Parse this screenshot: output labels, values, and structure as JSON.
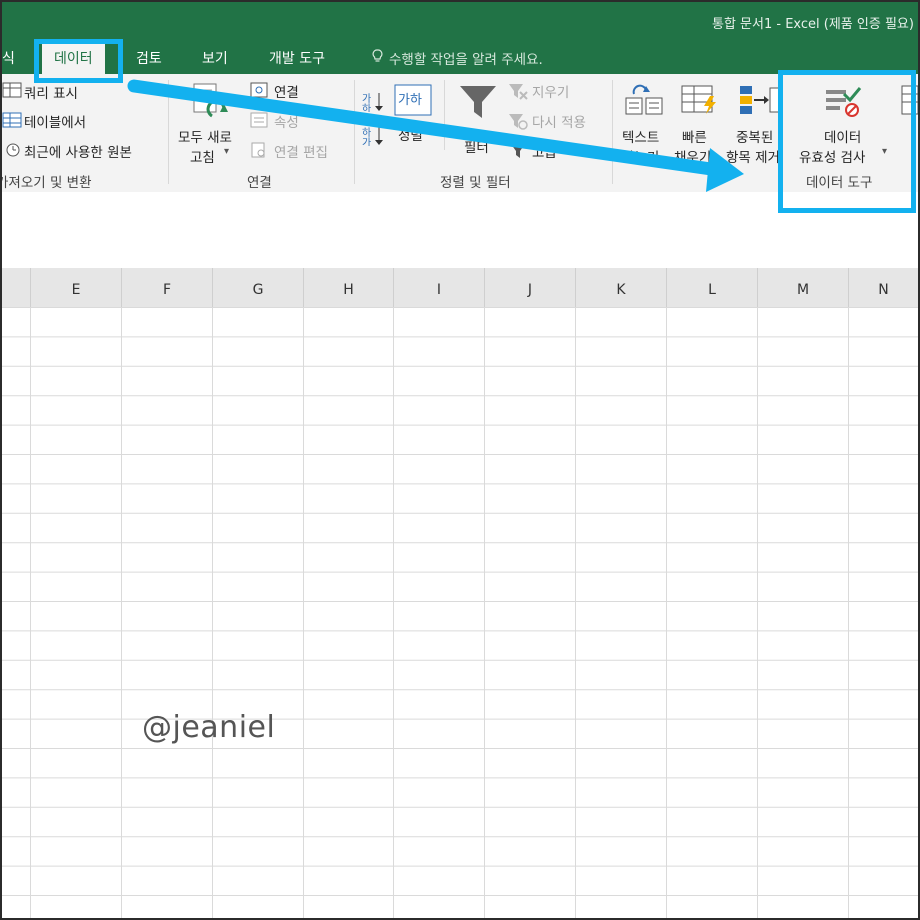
{
  "window": {
    "title": "통합 문서1 - Excel (제품 인증 필요)"
  },
  "tabs": {
    "partial_left": "식",
    "data": "데이터",
    "review": "검토",
    "view": "보기",
    "developer": "개발 도구",
    "tell_me": "수행할 작업을 알려 주세요."
  },
  "ribbon": {
    "get_transform": {
      "show_queries": "쿼리 표시",
      "from_table": "테이블에서",
      "recent_sources": "최근에 사용한 원본",
      "group_label": "가져오기 및 변환"
    },
    "connections": {
      "refresh_all_line1": "모두 새로",
      "refresh_all_line2": "고침",
      "connections": "연결",
      "properties": "속성",
      "edit_links": "연결 편집",
      "group_label": "연결"
    },
    "sort_filter": {
      "sort": "정렬",
      "filter": "필터",
      "clear": "지우기",
      "reapply": "다시 적용",
      "advanced": "고급",
      "group_label": "정렬 및 필터"
    },
    "data_tools": {
      "text_to_columns_line1": "텍스트",
      "text_to_columns_line2": "나누기",
      "flash_fill_line1": "빠른",
      "flash_fill_line2": "채우기",
      "remove_dup_line1": "중복된",
      "remove_dup_line2": "항목 제거",
      "validation_line1": "데이터",
      "validation_line2": "유효성 검사",
      "group_label": "데이터 도구"
    }
  },
  "columns": [
    "E",
    "F",
    "G",
    "H",
    "I",
    "J",
    "K",
    "L",
    "M",
    "N"
  ],
  "watermark": "@jeaniel",
  "colors": {
    "excel_green": "#217346",
    "highlight": "#13b1ef"
  }
}
